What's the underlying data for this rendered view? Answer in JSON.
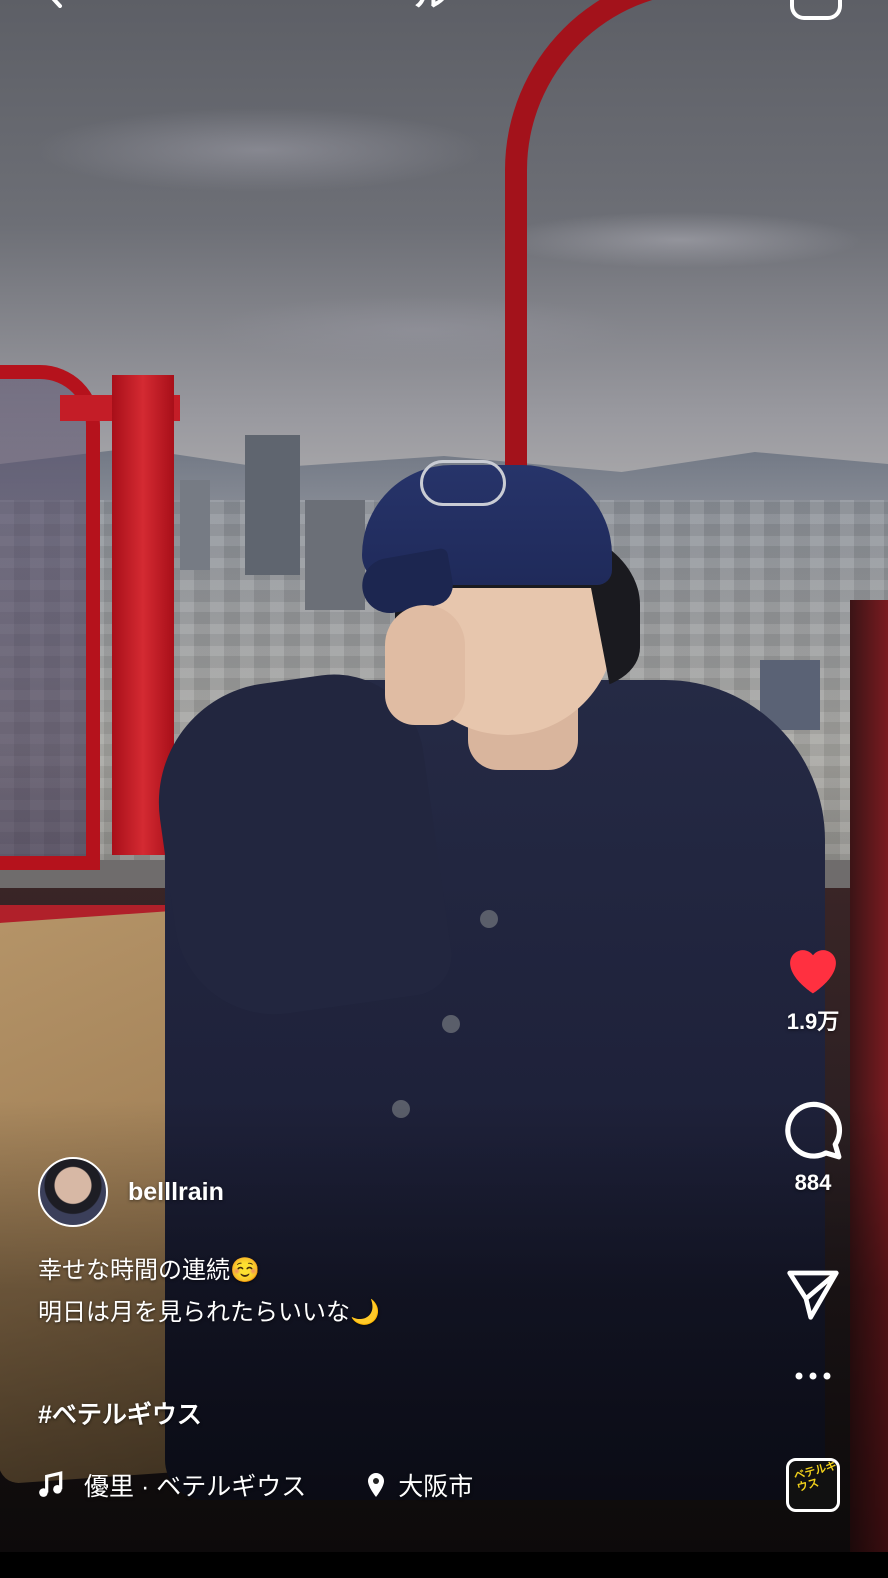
{
  "header": {
    "title_fragment": "ール"
  },
  "actions": {
    "like_count": "1.9万",
    "comment_count": "884",
    "audio_thumb_text": "ベテルギウス",
    "colors": {
      "like": "#ff3040"
    }
  },
  "post": {
    "username": "belllrain",
    "caption_line1": "幸せな時間の連続☺️",
    "caption_line2": "明日は月を見られたらいいな🌙",
    "hashtag": "#ベテルギウス",
    "audio": "優里 · ベテルギウス",
    "location": "大阪市"
  }
}
